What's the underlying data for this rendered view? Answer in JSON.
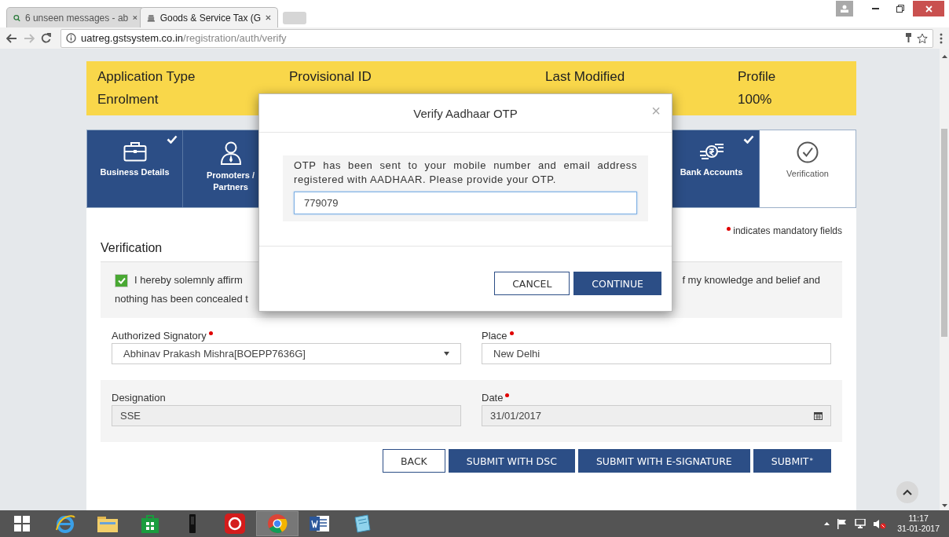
{
  "browser": {
    "tabs": [
      {
        "title": "6 unseen messages - ab",
        "selected": false
      },
      {
        "title": "Goods & Service Tax (G",
        "selected": true
      }
    ],
    "url_host": "uatreg.gstsystem.co.in",
    "url_path": "/registration/auth/verify"
  },
  "summary": [
    {
      "label": "Application Type",
      "value": "Enrolment"
    },
    {
      "label": "Provisional ID"
    },
    {
      "label": "Last Modified"
    },
    {
      "label": "Profile",
      "value": "100%"
    }
  ],
  "steps": [
    {
      "label": "Business Details",
      "kind": "briefcase",
      "completed": true,
      "selected": false
    },
    {
      "label": "Promoters / Partners",
      "kind": "person",
      "selected": false
    },
    {
      "label": "Bank Accounts",
      "kind": "coins",
      "completed": true,
      "selected": false
    },
    {
      "label": "Verification",
      "kind": "check-circle",
      "completed": false,
      "selected": true
    }
  ],
  "mandatory_note": "indicates mandatory fields",
  "section_title": "Verification",
  "declaration": {
    "checked": true,
    "line_1_start": "I hereby solemnly affirm",
    "line_1_end": "f my knowledge and belief and",
    "line_2_start": "nothing has been concealed t"
  },
  "fields": [
    {
      "label": "Authorized Signatory",
      "required": true,
      "kind": "select",
      "value": "Abhinav Prakash Mishra[BOEPP7636G]",
      "disabled": false
    },
    {
      "label": "Place",
      "required": true,
      "kind": "text",
      "value": "New Delhi",
      "disabled": false
    },
    {
      "label": "Designation",
      "required": false,
      "kind": "text",
      "value": "SSE",
      "disabled": true
    },
    {
      "label": "Date",
      "required": true,
      "kind": "date",
      "value": "31/01/2017",
      "disabled": true
    }
  ],
  "buttons": [
    {
      "label": "BACK",
      "kind": "outline"
    },
    {
      "label": "SUBMIT WITH DSC",
      "kind": "primary"
    },
    {
      "label": "SUBMIT WITH E-SIGNATURE",
      "kind": "primary"
    },
    {
      "label": "SUBMIT",
      "kind": "primary",
      "superscript": "*"
    }
  ],
  "modal": {
    "title": "Verify Aadhaar OTP",
    "close": "×",
    "message": "OTP has been sent to your mobile number and email address registered with AADHAAR. Please provide your OTP.",
    "otp_value": "779079",
    "buttons": [
      {
        "label": "CANCEL",
        "kind": "outline"
      },
      {
        "label": "CONTINUE",
        "kind": "primary"
      }
    ]
  },
  "taskbar": {
    "apps": [
      {
        "kind": "ie",
        "selected": false
      },
      {
        "kind": "folder",
        "selected": false
      },
      {
        "kind": "store",
        "selected": false
      },
      {
        "kind": "phone",
        "selected": false
      },
      {
        "kind": "red-app",
        "selected": false
      },
      {
        "kind": "chrome",
        "selected": true
      },
      {
        "kind": "word",
        "selected": false
      },
      {
        "kind": "notepad",
        "selected": false
      }
    ],
    "time": "11:17",
    "date": "31-01-2017"
  }
}
